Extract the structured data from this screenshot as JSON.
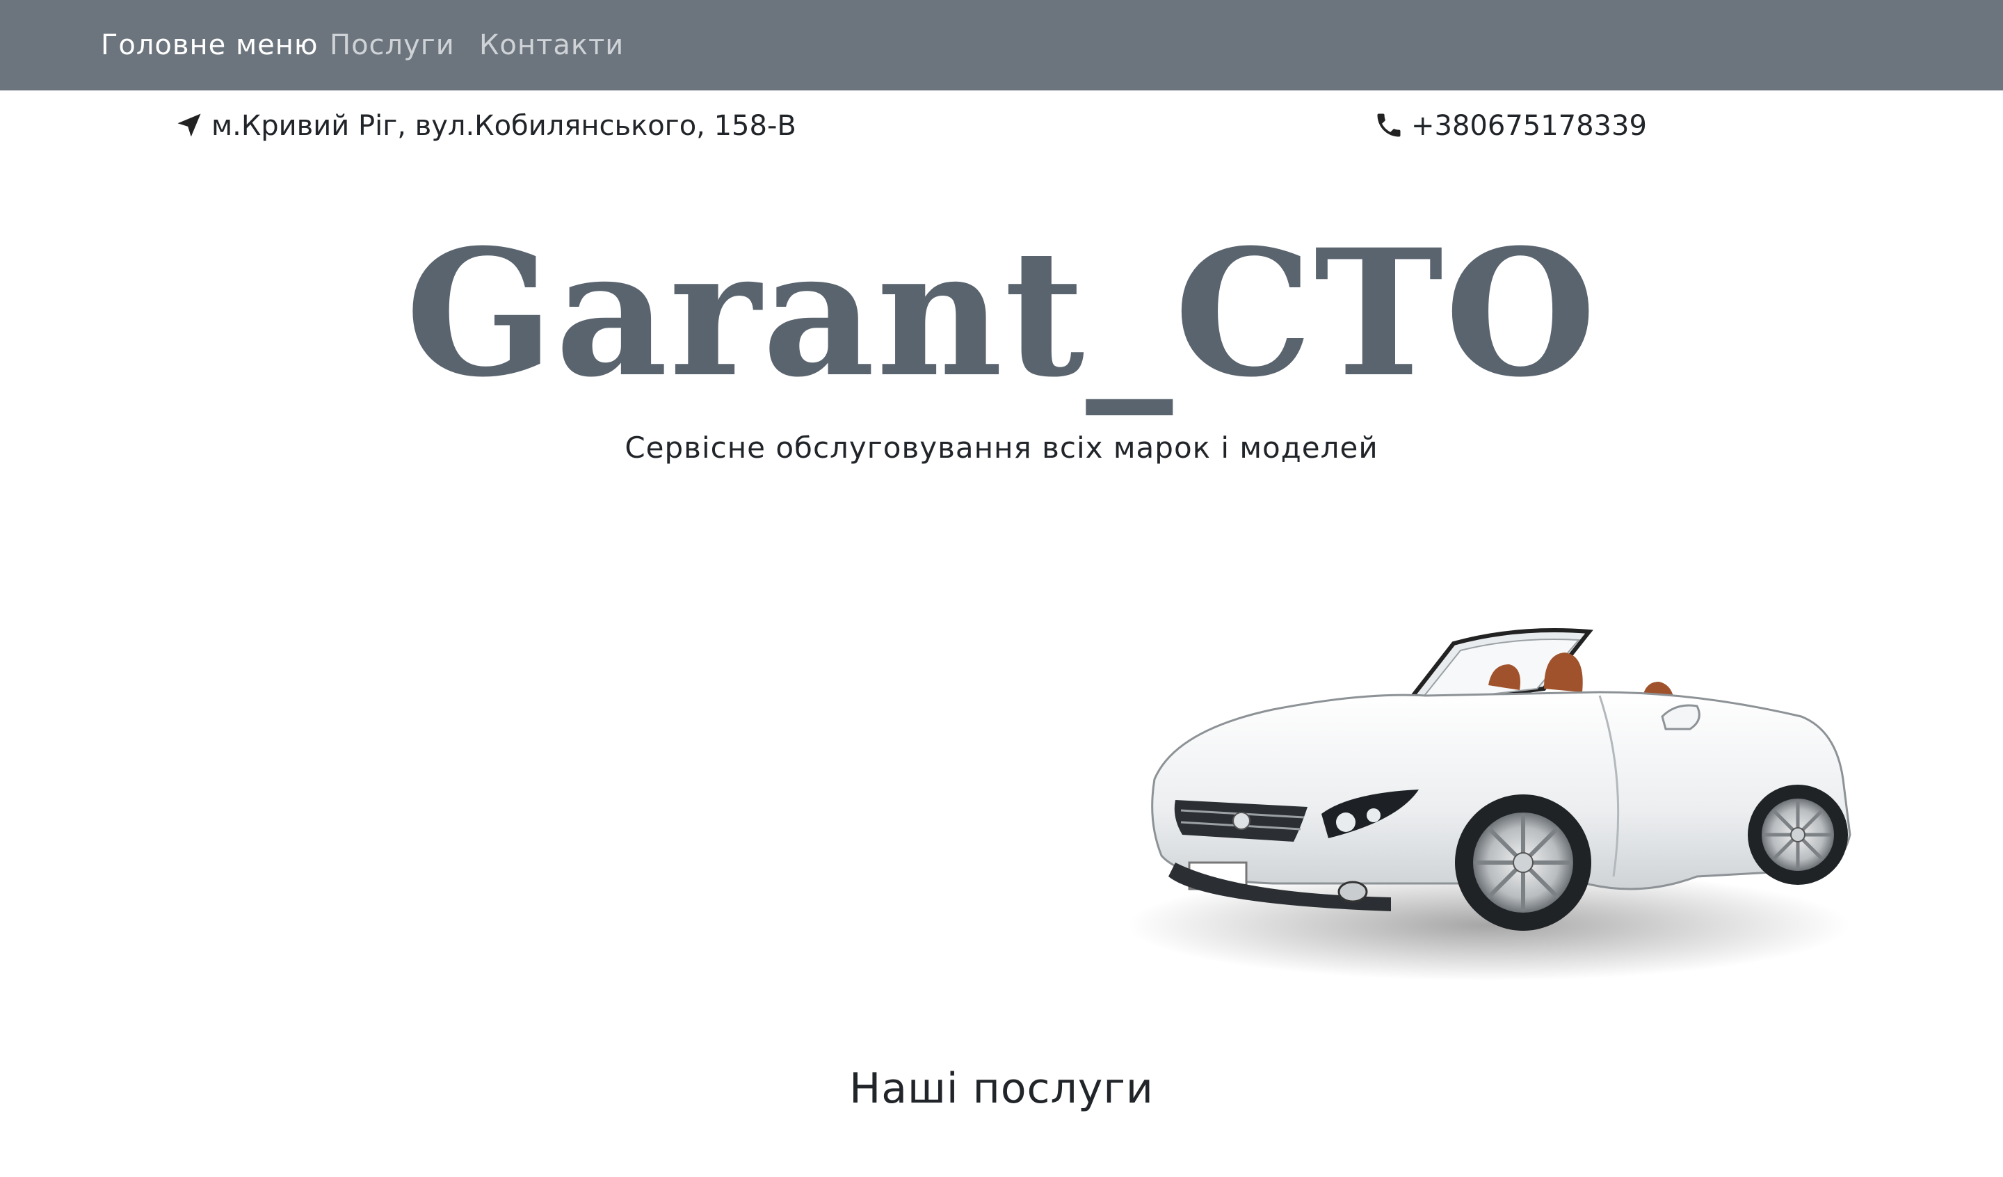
{
  "nav": {
    "home": "Головне меню",
    "services": "Послуги",
    "contacts": "Контакти"
  },
  "contact": {
    "address": "м.Кривий Ріг, вул.Кобилянського, 158-В",
    "address_icon": "location-arrow-icon",
    "phone": "+380675178339",
    "phone_icon": "phone-icon"
  },
  "hero": {
    "title": "Garant_CTO",
    "subtitle": "Сервісне обслуговування всіх марок і моделей",
    "image": "white-convertible-car"
  },
  "services_section": {
    "title": "Наші послуги"
  },
  "colors": {
    "nav_bg": "#6c757d",
    "brand": "#5a646e",
    "nav_active": "#ffffff",
    "nav_inactive": "#cfd3d7"
  }
}
